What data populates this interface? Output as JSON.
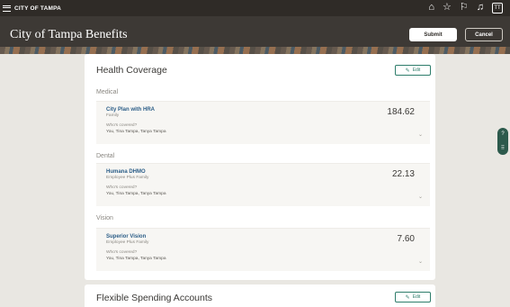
{
  "topbar": {
    "brand": "CITY OF TAMPA",
    "icons": [
      "home-icon",
      "star-icon",
      "flag-icon",
      "bell-icon"
    ],
    "avatar_initials": "TT"
  },
  "header": {
    "title": "City of Tampa Benefits",
    "submit_label": "Submit",
    "cancel_label": "Cancel"
  },
  "health": {
    "title": "Health Coverage",
    "edit_label": "Edit",
    "sections": [
      {
        "label": "Medical",
        "plan_name": "City Plan with HRA",
        "plan_level": "Family",
        "price": "184.62",
        "covered_label": "Who's covered?",
        "covered_value": "You, Tina Tampa, Tanya Tampa"
      },
      {
        "label": "Dental",
        "plan_name": "Humana DHMO",
        "plan_level": "Employee Plus Family",
        "price": "22.13",
        "covered_label": "Who's covered?",
        "covered_value": "You, Tina Tampa, Tanya Tampa"
      },
      {
        "label": "Vision",
        "plan_name": "Superior Vision",
        "plan_level": "Employee Plus Family",
        "price": "7.60",
        "covered_label": "Who's covered?",
        "covered_value": "You, Tina Tampa, Tanya Tampa"
      }
    ]
  },
  "fsa": {
    "title": "Flexible Spending Accounts",
    "edit_label": "Edit"
  },
  "colors": {
    "topbar": "#2f2b27",
    "header": "#3d3935",
    "link": "#2b5d87",
    "accent": "#2e7d6b"
  }
}
